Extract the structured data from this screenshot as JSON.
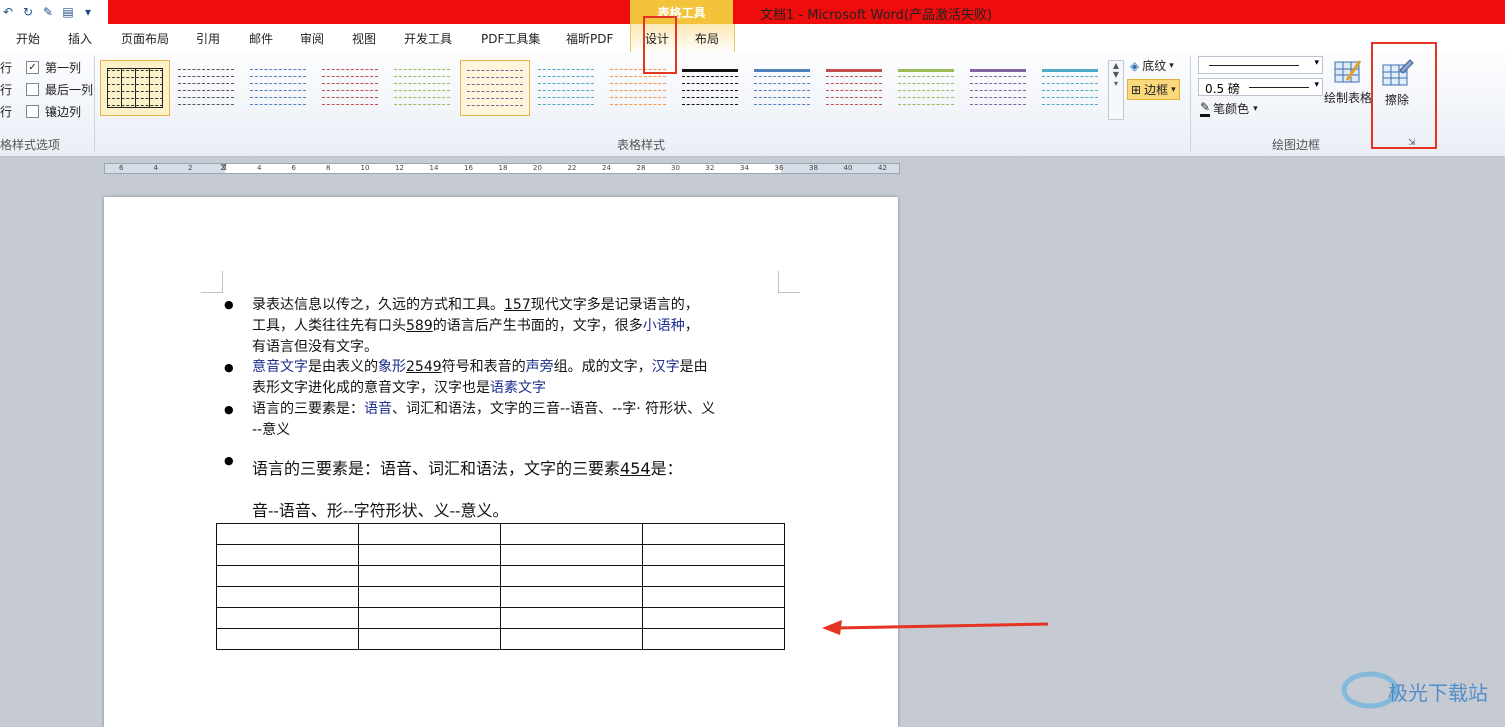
{
  "title_bar": {
    "context_tag": "表格工具",
    "window_title": "文档1 - Microsoft Word(产品激活失败)"
  },
  "tabs": [
    "开始",
    "插入",
    "页面布局",
    "引用",
    "邮件",
    "审阅",
    "视图",
    "开发工具",
    "PDF工具集",
    "福昕PDF",
    "设计",
    "布局"
  ],
  "ribbon": {
    "options": {
      "row1_prefix": "行",
      "row1_label": "第一列",
      "row2_prefix": "行",
      "row2_label": "最后一列",
      "row3_prefix": "行",
      "row3_label": "镶边列",
      "group_label": "格样式选项"
    },
    "styles_group_label": "表格样式",
    "shading_label": "底纹",
    "border_label": "边框",
    "weight_value": "0.5 磅",
    "pen_color_label": "笔颜色",
    "draw_table_label": "绘制表格",
    "erase_label": "擦除",
    "draw_borders_label": "绘图边框"
  },
  "ruler_numbers": [
    "6",
    "4",
    "2",
    "2",
    "4",
    "6",
    "8",
    "10",
    "12",
    "14",
    "16",
    "18",
    "20",
    "22",
    "24",
    "28",
    "30",
    "32",
    "34",
    "36",
    "38",
    "40",
    "42"
  ],
  "document": {
    "p1": {
      "line1a": "录表达信息以传之，久远的方式和工具。",
      "line1b": "157",
      "line1c": "现代文字多是记录语言的，",
      "line2a": "工具，人类往往先有口头",
      "line2b": "589",
      "line2c": "的语言后产生书面的，文字，很多",
      "line2d": "小语种",
      "line2e": "，",
      "line3": "有语言但没有文字。"
    },
    "p2": {
      "a": "意音文字",
      "b": "是由表义的",
      "c": "象形",
      "d": "2549",
      "e": "符号和表音的",
      "f": "声旁",
      "g": "组。成的文字，",
      "h": "汉字",
      "i": "是由",
      "line2a": "表形文字进化成的意音文字，汉字也是",
      "line2b": "语素文字"
    },
    "p3": {
      "a": "语言的三要素是：",
      "b": "语音",
      "c": "、词汇和语法，文字的三音--语音、--字· 符形状、义",
      "line2": "--意义"
    },
    "p4": {
      "a": "语言的三要素是：语音、词汇和语法，文字的三要素",
      "b": "454",
      "c": "是：",
      "line2": "音--语音、形--字符形状、义--意义。"
    }
  },
  "table_rows": 6,
  "table_cols": 4,
  "watermark_text": "极光下载站",
  "colors": {
    "title_red": "#ee0c0c",
    "context_gold": "#f3c33b",
    "highlight_red": "#e53324",
    "link_blue": "#1b2d8e"
  }
}
